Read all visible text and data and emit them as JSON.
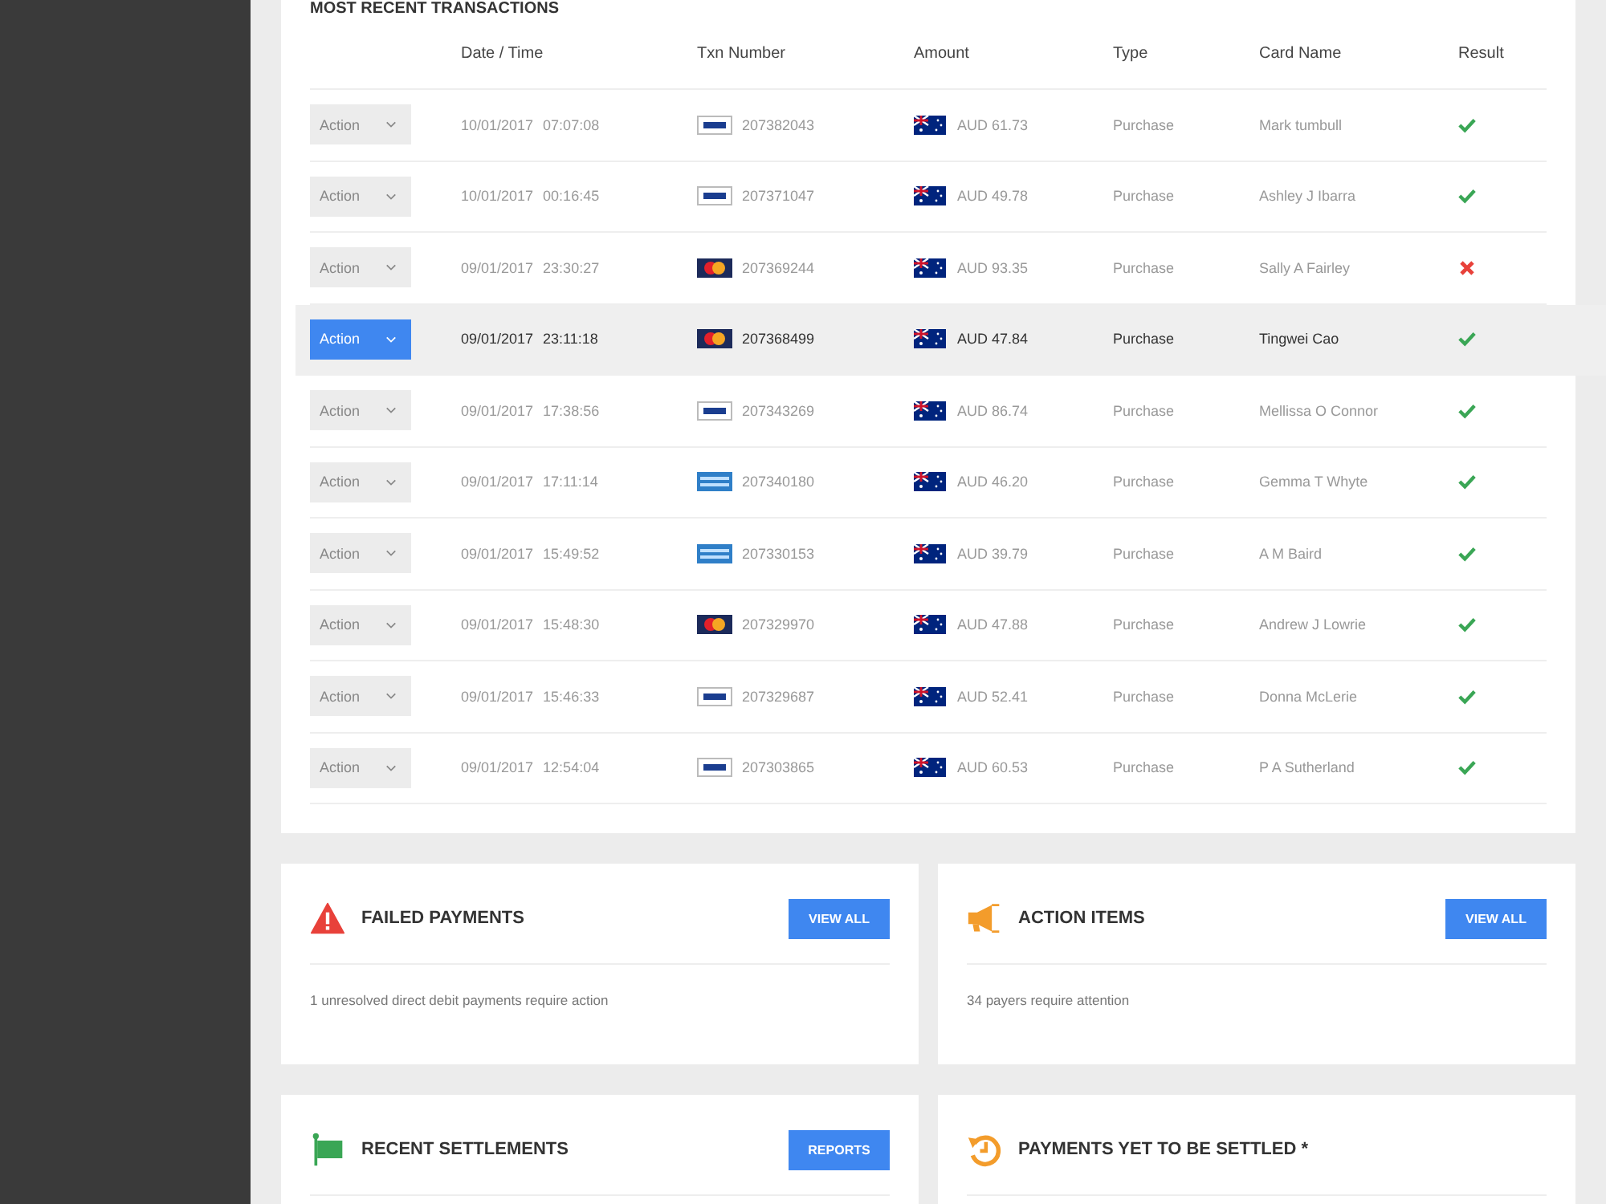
{
  "section_title": "MOST RECENT TRANSACTIONS",
  "table": {
    "columns": [
      "Date / Time",
      "Txn Number",
      "Amount",
      "Type",
      "Card Name",
      "Result"
    ],
    "rows": [
      {
        "action": "Action",
        "date": "10/01/2017",
        "time": "07:07:08",
        "card": {
          "kind": "visa"
        },
        "txn": "207382043",
        "amount": "AUD 61.73",
        "type": "Purchase",
        "card_name": "Mark tumbull",
        "failed": false,
        "selected": false
      },
      {
        "action": "Action",
        "date": "10/01/2017",
        "time": "00:16:45",
        "card": {
          "kind": "visa"
        },
        "txn": "207371047",
        "amount": "AUD 49.78",
        "type": "Purchase",
        "card_name": "Ashley J Ibarra",
        "failed": false,
        "selected": false
      },
      {
        "action": "Action",
        "date": "09/01/2017",
        "time": "23:30:27",
        "card": {
          "kind": "mastercard"
        },
        "txn": "207369244",
        "amount": "AUD 93.35",
        "type": "Purchase",
        "card_name": "Sally A Fairley",
        "failed": true,
        "selected": false
      },
      {
        "action": "Action",
        "date": "09/01/2017",
        "time": "23:11:18",
        "card": {
          "kind": "mastercard"
        },
        "txn": "207368499",
        "amount": "AUD 47.84",
        "type": "Purchase",
        "card_name": "Tingwei Cao",
        "failed": false,
        "selected": true
      },
      {
        "action": "Action",
        "date": "09/01/2017",
        "time": "17:38:56",
        "card": {
          "kind": "visa"
        },
        "txn": "207343269",
        "amount": "AUD 86.74",
        "type": "Purchase",
        "card_name": "Mellissa O Connor",
        "failed": false,
        "selected": false
      },
      {
        "action": "Action",
        "date": "09/01/2017",
        "time": "17:11:14",
        "card": {
          "kind": "amex"
        },
        "txn": "207340180",
        "amount": "AUD 46.20",
        "type": "Purchase",
        "card_name": "Gemma T Whyte",
        "failed": false,
        "selected": false
      },
      {
        "action": "Action",
        "date": "09/01/2017",
        "time": "15:49:52",
        "card": {
          "kind": "amex"
        },
        "txn": "207330153",
        "amount": "AUD 39.79",
        "type": "Purchase",
        "card_name": "A M Baird",
        "failed": false,
        "selected": false
      },
      {
        "action": "Action",
        "date": "09/01/2017",
        "time": "15:48:30",
        "card": {
          "kind": "mastercard"
        },
        "txn": "207329970",
        "amount": "AUD 47.88",
        "type": "Purchase",
        "card_name": "Andrew J Lowrie",
        "failed": false,
        "selected": false
      },
      {
        "action": "Action",
        "date": "09/01/2017",
        "time": "15:46:33",
        "card": {
          "kind": "visa"
        },
        "txn": "207329687",
        "amount": "AUD 52.41",
        "type": "Purchase",
        "card_name": "Donna McLerie",
        "failed": false,
        "selected": false
      },
      {
        "action": "Action",
        "date": "09/01/2017",
        "time": "12:54:04",
        "card": {
          "kind": "visa"
        },
        "txn": "207303865",
        "amount": "AUD 60.53",
        "type": "Purchase",
        "card_name": "P A Sutherland",
        "failed": false,
        "selected": false
      }
    ]
  },
  "panels": [
    {
      "kind": "warning",
      "title": "FAILED PAYMENTS",
      "button": "VIEW ALL",
      "message": "1 unresolved direct debit payments require action"
    },
    {
      "kind": "megaphone",
      "title": "ACTION ITEMS",
      "button": "VIEW ALL",
      "message": "34 payers require attention"
    },
    {
      "kind": "flag",
      "title": "RECENT SETTLEMENTS",
      "button": "REPORTS"
    },
    {
      "kind": "history",
      "title": "PAYMENTS YET TO BE SETTLED *"
    }
  ]
}
